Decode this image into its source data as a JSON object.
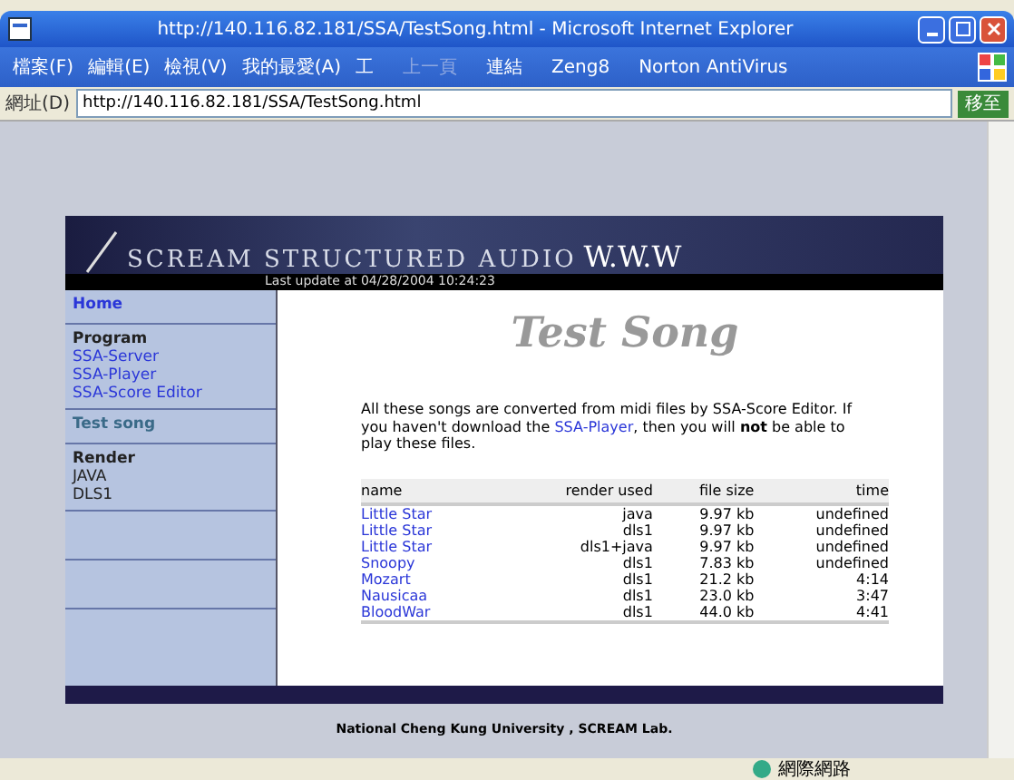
{
  "window": {
    "title": "http://140.116.82.181/SSA/TestSong.html - Microsoft Internet Explorer"
  },
  "menu": [
    "檔案(F)",
    "編輯(E)",
    "檢視(V)",
    "我的最愛(A)",
    "工"
  ],
  "toolbar": [
    {
      "label": "上一頁",
      "disabled": true
    },
    {
      "label": "連結",
      "disabled": false
    },
    {
      "label": "Zeng8",
      "disabled": false
    },
    {
      "label": "Norton AntiVirus",
      "disabled": false
    }
  ],
  "address": {
    "label": "網址(D)",
    "value": "http://140.116.82.181/SSA/TestSong.html",
    "go": "移至"
  },
  "banner": {
    "title": "SCREAM STRUCTURED AUDIO",
    "suffix": "W.W.W",
    "update": "Last update at 04/28/2004 10:24:23"
  },
  "sidebar": [
    {
      "items": [
        {
          "text": "Home",
          "kind": "link"
        }
      ]
    },
    {
      "items": [
        {
          "text": "Program",
          "kind": "heading"
        },
        {
          "text": "SSA-Server",
          "kind": "link"
        },
        {
          "text": "SSA-Player",
          "kind": "link"
        },
        {
          "text": "SSA-Score Editor",
          "kind": "link"
        }
      ]
    },
    {
      "items": [
        {
          "text": "Test song",
          "kind": "current"
        }
      ]
    },
    {
      "items": [
        {
          "text": "Render",
          "kind": "heading"
        },
        {
          "text": "JAVA",
          "kind": "text"
        },
        {
          "text": "DLS1",
          "kind": "text"
        }
      ]
    },
    {
      "kind": "blank"
    },
    {
      "kind": "blank"
    }
  ],
  "heading": "Test Song",
  "intro": "All these songs are converted from midi files by SSA-Score Editor. If you haven't download the ",
  "intro_link": "SSA-Player",
  "intro_end": ", then you will **not** be able to play these files.",
  "table": {
    "columns": [
      "name",
      "render used",
      "file size",
      "time"
    ],
    "rows": [
      [
        "Little Star",
        "java",
        "9.97 kb",
        "undefined"
      ],
      [
        "Little Star",
        "dls1",
        "9.97 kb",
        "undefined"
      ],
      [
        "Little Star",
        "dls1+java",
        "9.97 kb",
        "undefined"
      ],
      [
        "Snoopy",
        "dls1",
        "7.83 kb",
        "undefined"
      ],
      [
        "Mozart",
        "dls1",
        "21.2 kb",
        "4:14"
      ],
      [
        "Nausicaa",
        "dls1",
        "23.0 kb",
        "3:47"
      ],
      [
        "BloodWar",
        "dls1",
        "44.0 kb",
        "4:41"
      ]
    ]
  },
  "footer": "National Cheng Kung University , SCREAM Lab.",
  "status": {
    "zone": "網際網路"
  }
}
